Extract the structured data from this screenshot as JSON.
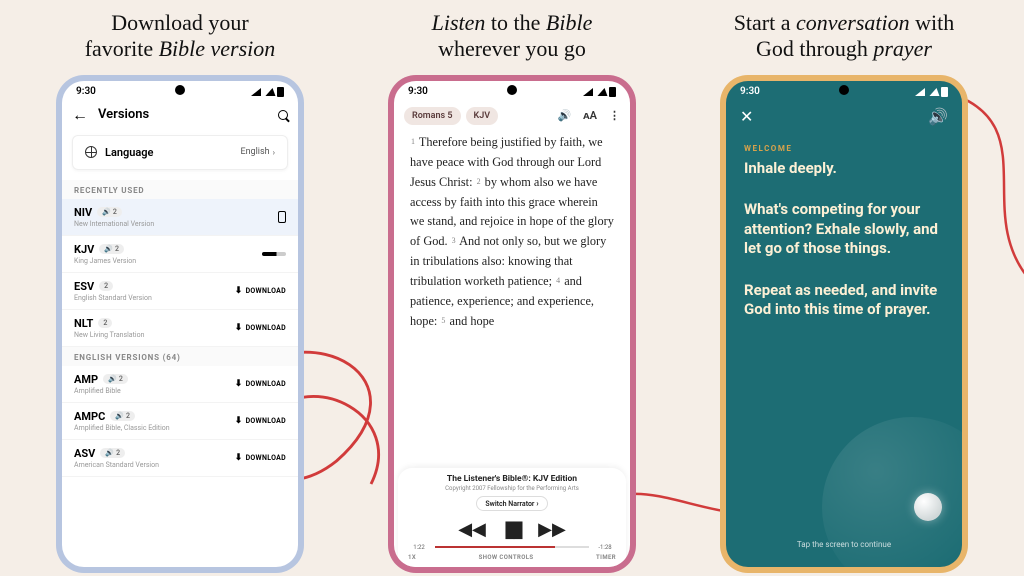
{
  "panel1": {
    "headline_a": "Download your",
    "headline_b": "favorite ",
    "headline_em": "Bible version",
    "status_time": "9:30",
    "versions_title": "Versions",
    "language_label": "Language",
    "language_value": "English",
    "section_recent": "RECENTLY USED",
    "section_english": "ENGLISH VERSIONS (64)",
    "download_label": "DOWNLOAD",
    "versions": {
      "recent": [
        {
          "abbr": "NIV",
          "full": "New International Version",
          "badge": "2",
          "has_audio": true,
          "selected": true,
          "action": "device"
        },
        {
          "abbr": "KJV",
          "full": "King James Version",
          "badge": "2",
          "has_audio": true,
          "action": "bar"
        },
        {
          "abbr": "ESV",
          "full": "English Standard Version",
          "badge": "2",
          "has_audio": false,
          "action": "download"
        },
        {
          "abbr": "NLT",
          "full": "New Living Translation",
          "badge": "2",
          "has_audio": false,
          "action": "download"
        }
      ],
      "english": [
        {
          "abbr": "AMP",
          "full": "Amplified Bible",
          "badge": "2",
          "has_audio": true,
          "action": "download"
        },
        {
          "abbr": "AMPC",
          "full": "Amplified Bible, Classic Edition",
          "badge": "2",
          "has_audio": true,
          "action": "download"
        },
        {
          "abbr": "ASV",
          "full": "American Standard Version",
          "badge": "2",
          "has_audio": true,
          "action": "download"
        }
      ]
    }
  },
  "panel2": {
    "headline_em_a": "Listen",
    "headline_mid": " to the ",
    "headline_em_b": "Bible",
    "headline_b": "wherever you go",
    "status_time": "9:30",
    "book_chip": "Romans 5",
    "version_chip": "KJV",
    "verse_text_1": "Therefore being justified by faith, we have peace with God through our Lord Jesus Christ: ",
    "verse_text_2": "by whom also we have access by faith into this grace wherein we stand, and rejoice in hope of the glory of God. ",
    "verse_text_3": "And not only so, but we glory in tribulations also: knowing that tribulation worketh patience; ",
    "verse_text_4": "and patience, experience; and experience, hope: ",
    "verse_text_5": "and hope",
    "player_title": "The Listener's Bible®: KJV Edition",
    "player_copy": "Copyright 2007 Fellowship for the Performing Arts",
    "switch_narrator": "Switch Narrator",
    "time_elapsed": "1:22",
    "time_remaining": "-1:28",
    "foot_1x": "1X",
    "foot_show": "SHOW CONTROLS",
    "foot_timer": "TIMER"
  },
  "panel3": {
    "headline_a": "Start a ",
    "headline_em_a": "conversation",
    "headline_mid": " with",
    "headline_b": "God through ",
    "headline_em_b": "prayer",
    "status_time": "9:30",
    "welcome": "WELCOME",
    "line1": "Inhale deeply.",
    "line2": "What's competing for your attention? Exhale slowly, and let go of those things.",
    "line3": "Repeat as needed, and invite God into this time of prayer.",
    "tap_hint": "Tap the screen to continue"
  }
}
